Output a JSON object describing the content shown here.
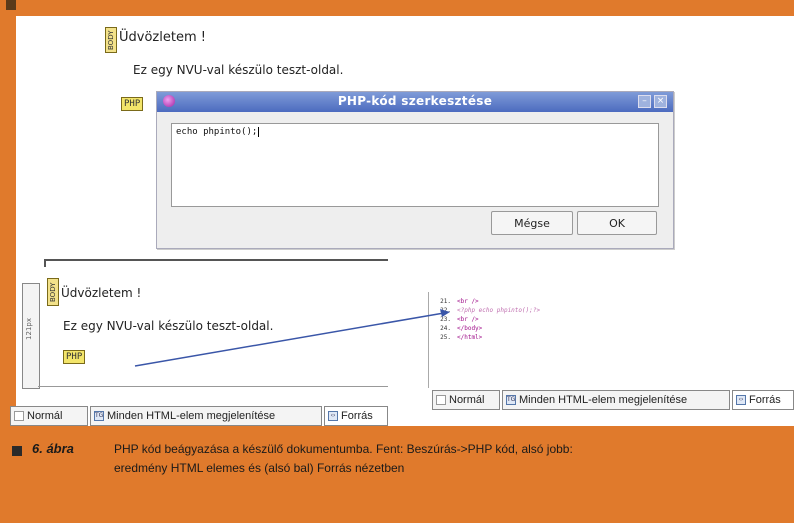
{
  "top_editor": {
    "body_tag": "BODY",
    "greeting": "Üdvözletem !",
    "body_text": "Ez egy NVU-val készülo teszt-oldal.",
    "php_tag": "PHP"
  },
  "dialog": {
    "title": "PHP-kód szerkesztése",
    "code": "echo phpinto();",
    "cancel_label": "Mégse",
    "ok_label": "OK"
  },
  "left_editor": {
    "body_tag": "BODY",
    "ruler_label": "121px",
    "greeting": "Üdvözletem !",
    "body_text": "Ez egy NVU-val készülo teszt-oldal.",
    "php_tag": "PHP",
    "tabs": [
      "Normál",
      "Minden HTML-elem megjelenítése",
      "Forrás"
    ]
  },
  "right_source": {
    "lines": [
      {
        "num": "21.",
        "code": "<br />"
      },
      {
        "num": "22.",
        "code": "<?php echo phpinto();?>"
      },
      {
        "num": "23.",
        "code": "<br />"
      },
      {
        "num": "24.",
        "code": "</body>"
      },
      {
        "num": "25.",
        "code": "</html>"
      }
    ],
    "tabs": [
      "Normál",
      "Minden HTML-elem megjelenítése",
      "Forrás"
    ]
  },
  "caption": {
    "label": "6. ábra",
    "line1": "PHP kód beágyazása a készülő dokumentumba. Fent: Beszúrás->PHP kód, alsó jobb:",
    "line2": "eredmény HTML elemes és (alsó bal) Forrás nézetben"
  },
  "colors": {
    "background": "#e07a2c",
    "dialog_title": "#4c6bbf",
    "php_tag": "#f3e56a"
  }
}
